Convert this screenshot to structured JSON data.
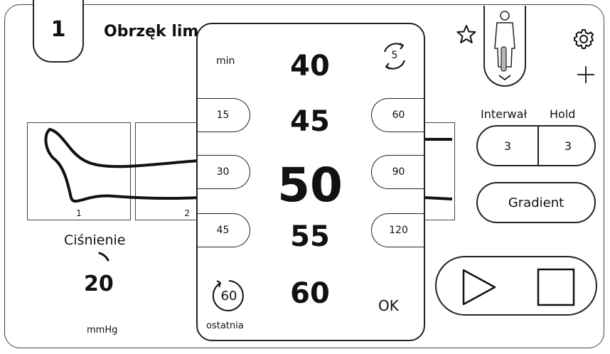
{
  "program": {
    "number": "1",
    "title": "Obrzęk lim"
  },
  "segments": [
    "1",
    "2"
  ],
  "pressure": {
    "label": "Ciśnienie",
    "value": "20",
    "unit": "mmHg"
  },
  "right_panel": {
    "interval_label": "Interwał",
    "hold_label": "Hold",
    "interval_value": "3",
    "hold_value": "3",
    "gradient_label": "Gradient"
  },
  "picker": {
    "unit_label": "min",
    "repeat_value": "5",
    "values": [
      "40",
      "45",
      "50",
      "55",
      "60"
    ],
    "selected": "50",
    "left_options": [
      "15",
      "30",
      "45"
    ],
    "right_options": [
      "60",
      "90",
      "120"
    ],
    "last_value": "60",
    "last_label": "ostatnia",
    "ok_label": "OK"
  },
  "icons": {
    "favorite": "star-icon",
    "settings": "gear-icon",
    "add": "plus-icon",
    "body": "body-figure-icon",
    "play": "play-icon",
    "stop": "stop-icon",
    "repeat": "repeat-icon",
    "history": "history-icon"
  },
  "colors": {
    "line": "#222222",
    "leg_bar": "#b8b8b8",
    "background": "#ffffff"
  }
}
